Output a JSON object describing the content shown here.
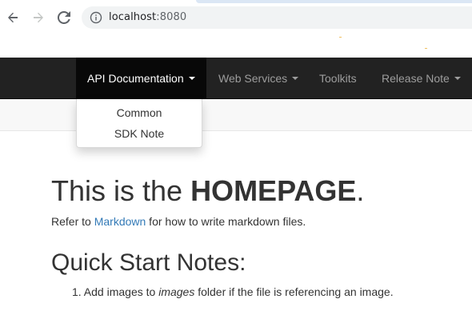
{
  "browser": {
    "url_host": "localhost",
    "url_port": ":8080"
  },
  "navbar": {
    "items": [
      {
        "label": "API Documentation",
        "active": true,
        "has_caret": true
      },
      {
        "label": "Web Services",
        "active": false,
        "has_caret": true
      },
      {
        "label": "Toolkits",
        "active": false,
        "has_caret": false
      },
      {
        "label": "Release Note",
        "active": false,
        "has_caret": true
      }
    ]
  },
  "dropdown": {
    "items": [
      {
        "label": "Common"
      },
      {
        "label": "SDK Note"
      }
    ]
  },
  "content": {
    "heading_prefix": "This is the ",
    "heading_strong": "HOMEPAGE",
    "heading_suffix": ".",
    "intro_before": "Refer to ",
    "intro_link": "Markdown",
    "intro_after": " for how to write markdown files.",
    "subheading": "Quick Start Notes:",
    "list": [
      {
        "number": "1.",
        "before": " Add images to ",
        "emphasis": "images",
        "after": " folder if the file is referencing an image."
      }
    ]
  },
  "colors": {
    "navbar_bg": "#222222",
    "navbar_active_bg": "#080808",
    "link": "#337ab7",
    "text": "#333333"
  }
}
